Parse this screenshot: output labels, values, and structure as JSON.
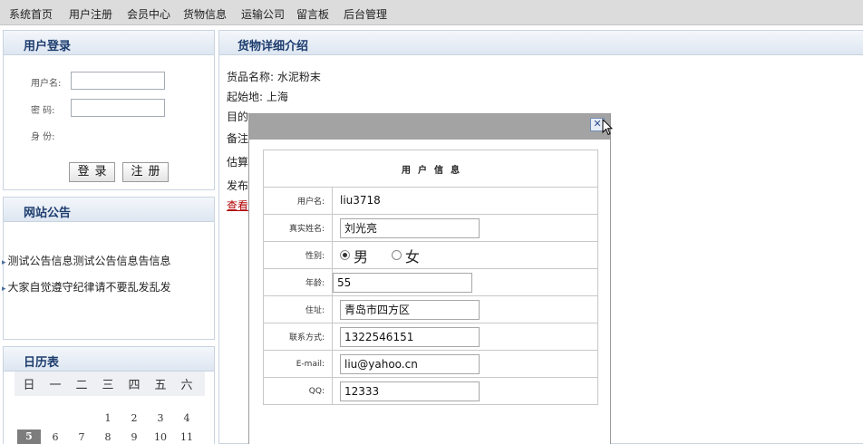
{
  "nav": [
    "系统首页",
    "用户注册",
    "会员中心",
    "货物信息",
    "运输公司",
    "留言板",
    "后台管理"
  ],
  "login": {
    "title": "用户登录",
    "username_label": "用户名:",
    "password_label": "密  码:",
    "identity_label": "身  份:",
    "login_button": "登录",
    "register_button": "注册"
  },
  "notice": {
    "title": "网站公告",
    "items": [
      "测试公告信息测试公告信息告信息",
      "大家自觉遵守纪律请不要乱发乱发"
    ]
  },
  "calendar": {
    "title": "日历表",
    "weekdays": [
      "日",
      "一",
      "二",
      "三",
      "四",
      "五",
      "六"
    ],
    "row1": [
      "1",
      "2",
      "3",
      "4"
    ],
    "row2": [
      "5",
      "6",
      "7",
      "8",
      "9",
      "10",
      "11"
    ],
    "today": "5"
  },
  "detail": {
    "title": "货物详细介绍",
    "lines": [
      "货品名称: 水泥粉末",
      "起始地: 上海",
      "目的",
      "备注",
      "估算",
      "发布"
    ],
    "link": "查看"
  },
  "user_info": {
    "title": "用户信息",
    "username_label": "用户名:",
    "username": "liu3718",
    "realname_label": "真实姓名:",
    "realname": "刘光亮",
    "gender_label": "性别:",
    "gender_male": "男",
    "gender_female": "女",
    "age_label": "年龄:",
    "age": "55",
    "address_label": "住址:",
    "address": "青岛市四方区",
    "phone_label": "联系方式:",
    "phone": "1322546151",
    "email_label": "E-mail:",
    "email": "liu@yahoo.cn",
    "qq_label": "QQ:",
    "qq": "12333"
  },
  "icons": {
    "close": "close-icon",
    "cursor": "mouse-pointer-icon",
    "notice_bullet": "arrow-right-icon"
  }
}
